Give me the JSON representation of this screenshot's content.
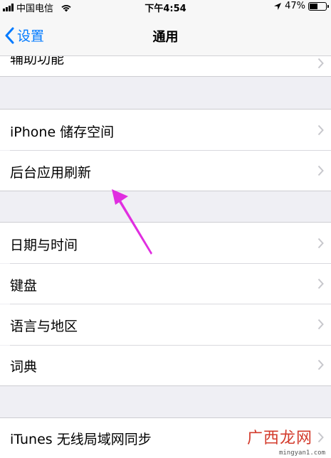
{
  "status_bar": {
    "carrier": "中国电信",
    "time": "下午4:54",
    "battery": "47%",
    "battery_level": 0.47
  },
  "nav": {
    "back_label": "设置",
    "title": "通用"
  },
  "rows": {
    "accessibility": "辅助功能",
    "storage": "iPhone 储存空间",
    "background_refresh": "后台应用刷新",
    "date_time": "日期与时间",
    "keyboard": "键盘",
    "language_region": "语言与地区",
    "dictionary": "词典",
    "itunes_sync": "iTunes 无线局域网同步"
  },
  "annotation": {
    "arrow_color": "#e02ee0"
  },
  "watermark": {
    "logo": "广西龙网",
    "url": "mingyan1.com"
  },
  "colors": {
    "accent": "#007aff",
    "background": "#efeff4"
  }
}
